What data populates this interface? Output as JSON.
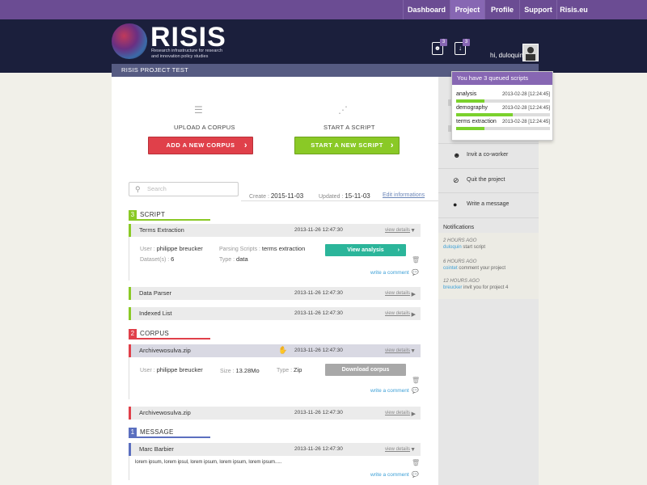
{
  "nav": {
    "items": [
      "Dashboard",
      "Project",
      "Profile",
      "Support",
      "Risis.eu"
    ],
    "active": "Project"
  },
  "header": {
    "logo": "RISIS",
    "tagline": "Research infrastructure for research and innovation policy studies",
    "badge1_count": "3",
    "badge2_count": "3",
    "greeting": "hi, duloquin"
  },
  "project": {
    "title": "RISIS PROJECT TEST"
  },
  "actions": {
    "upload_title": "UPLOAD A CORPUS",
    "upload_button": "ADD A NEW CORPUS",
    "script_title": "START A SCRIPT",
    "script_button": "START A NEW SCRIPT"
  },
  "search": {
    "placeholder": "Search"
  },
  "meta": {
    "create_label": "Create :",
    "create_date": "2015-11-03",
    "updated_label": "Updated :",
    "updated_date": "15-11-03",
    "edit_link": "Edit informations"
  },
  "sections": {
    "script": {
      "num": "3",
      "label": "SCRIPT"
    },
    "corpus": {
      "num": "2",
      "label": "CORPUS"
    },
    "message": {
      "num": "1",
      "label": "MESSAGE"
    }
  },
  "rows": {
    "terms": {
      "title": "Terms Extraction",
      "date": "2013-11-26 12:47:30",
      "view": "view details"
    },
    "parser": {
      "title": "Data Parser",
      "date": "2013-11-26 12:47:30",
      "view": "view details"
    },
    "indexed": {
      "title": "Indexed List",
      "date": "2013-11-26 12:47:30",
      "view": "view details"
    },
    "corpus1": {
      "title": "Archivewosulva.zip",
      "date": "2013-11-26 12:47:30",
      "view": "view details"
    },
    "corpus2": {
      "title": "Archivewosulva.zip",
      "date": "2013-11-26 12:47:30",
      "view": "view details"
    },
    "msg": {
      "title": "Marc Barbier",
      "date": "2013-11-26 12:47:30",
      "view": "view details"
    }
  },
  "terms_detail": {
    "user_label": "User :",
    "user": "philippe breucker",
    "dataset_label": "Dataset(s) :",
    "dataset": "6",
    "parsing_label": "Parsing Scripts :",
    "parsing": "terms extraction",
    "type_label": "Type :",
    "type": "data",
    "button": "View analysis",
    "comment": "write a comment"
  },
  "corpus_detail": {
    "user_label": "User :",
    "user": "philippe breucker",
    "size_label": "Size :",
    "size": "13.28Mo",
    "type_label": "Type :",
    "type": "Zip",
    "button": "Download corpus",
    "comment": "write a comment"
  },
  "msg_detail": {
    "text": "lorem ipsum, lorem ipsul, lorem ipsum, lorem ipsum, lorem ipsum.....",
    "comment": "write a comment"
  },
  "sidebar": {
    "invite": "Invit a co-worker",
    "quit": "Quit the project",
    "write": "Write a message",
    "notifications_title": "Notifications",
    "notifications": [
      {
        "time": "2 HOURS AGO",
        "user": "duloquin",
        "text": "start script"
      },
      {
        "time": "6 HOURS AGO",
        "user": "cointet",
        "text": "comment your project"
      },
      {
        "time": "12 HOURS AGO",
        "user": "breucker",
        "text": "invit you for project 4"
      }
    ]
  },
  "popup": {
    "title": "You have 3 queued scripts",
    "items": [
      {
        "name": "analysis",
        "date": "2013-02-28 [12:24:45]",
        "progress": 0.3
      },
      {
        "name": "demography",
        "date": "2013-02-28 [12:24:45]",
        "progress": 0.6
      },
      {
        "name": "terms extraction",
        "date": "2013-02-28 [12:24:45]",
        "progress": 0.3
      }
    ]
  },
  "colors": {
    "purple": "#6b4c93",
    "green": "#8ac926",
    "red": "#e0404a",
    "blue": "#5b6fbf",
    "teal": "#2bb59a"
  }
}
